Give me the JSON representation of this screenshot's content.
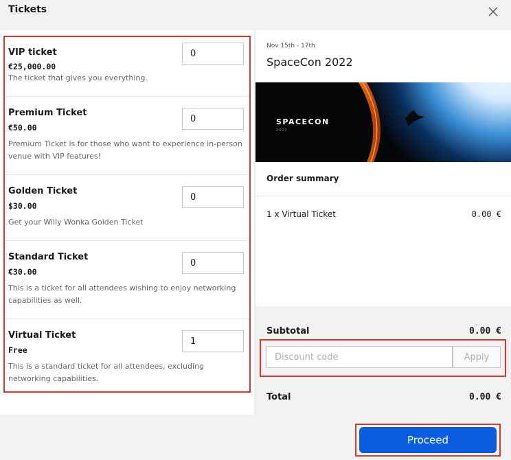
{
  "header": {
    "title": "Tickets",
    "close_icon": "close-icon"
  },
  "tickets": [
    {
      "name": "VIP ticket",
      "price": "€25,000.00",
      "description": "The ticket that gives you everything.",
      "quantity": "0"
    },
    {
      "name": "Premium Ticket",
      "price": "€50.00",
      "description": "Premium Ticket is for those who want to experience in-person venue with VIP features!",
      "quantity": "0"
    },
    {
      "name": "Golden Ticket",
      "price": "$30.00",
      "description": "Get your Willy Wonka Golden Ticket",
      "quantity": "0"
    },
    {
      "name": "Standard Ticket",
      "price": "€30.00",
      "description": "This is a ticket for all attendees wishing to enjoy networking capabilities as well.",
      "quantity": "0"
    },
    {
      "name": "Virtual Ticket",
      "price": "Free",
      "description": "This is a standard ticket for all attendees, excluding networking capabilities.",
      "quantity": "1"
    }
  ],
  "event": {
    "dates": "Nov 15th - 17th",
    "title": "SpaceCon 2022",
    "banner_text": "SPACECON",
    "banner_subtext": "2022"
  },
  "order_summary": {
    "label": "Order summary",
    "lines": [
      {
        "name": "1 x Virtual Ticket",
        "price": "0.00 €"
      }
    ]
  },
  "subtotal": {
    "label": "Subtotal",
    "value": "0.00 €"
  },
  "discount": {
    "placeholder": "Discount code",
    "apply_label": "Apply"
  },
  "total": {
    "label": "Total",
    "value": "0.00 €"
  },
  "footer": {
    "proceed_label": "Proceed"
  },
  "colors": {
    "accent": "#0b5de0",
    "highlight_border": "#e0352b"
  }
}
